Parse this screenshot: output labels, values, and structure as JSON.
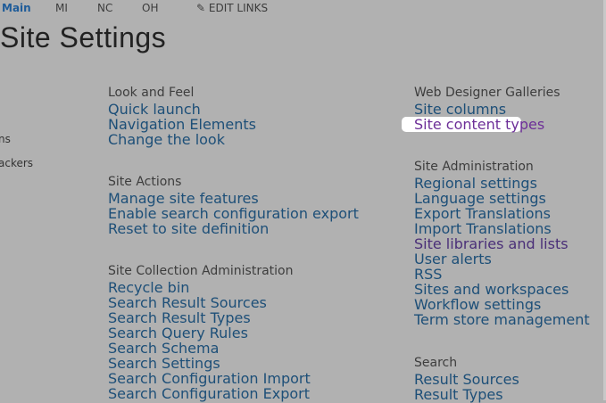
{
  "topnav": {
    "items": [
      "Main",
      "MI",
      "NC",
      "OH"
    ],
    "edit_links": "EDIT LINKS"
  },
  "page_title": "Site Settings",
  "side_fragments": [
    "ns",
    "ackers"
  ],
  "left_sections": [
    {
      "heading": "Look and Feel",
      "links": [
        "Quick launch",
        "Navigation Elements",
        "Change the look"
      ]
    },
    {
      "heading": "Site Actions",
      "links": [
        "Manage site features",
        "Enable search configuration export",
        "Reset to site definition"
      ]
    },
    {
      "heading": "Site Collection Administration",
      "links": [
        "Recycle bin",
        "Search Result Sources",
        "Search Result Types",
        "Search Query Rules",
        "Search Schema",
        "Search Settings",
        "Search Configuration Import",
        "Search Configuration Export"
      ]
    }
  ],
  "right_sections": [
    {
      "heading": "Web Designer Galleries",
      "links": [
        "Site columns",
        "Site content types"
      ]
    },
    {
      "heading": "Site Administration",
      "links": [
        "Regional settings",
        "Language settings",
        "Export Translations",
        "Import Translations",
        "Site libraries and lists",
        "User alerts",
        "RSS",
        "Sites and workspaces",
        "Workflow settings",
        "Term store management"
      ]
    },
    {
      "heading": "Search",
      "links": [
        "Result Sources",
        "Result Types"
      ]
    }
  ]
}
